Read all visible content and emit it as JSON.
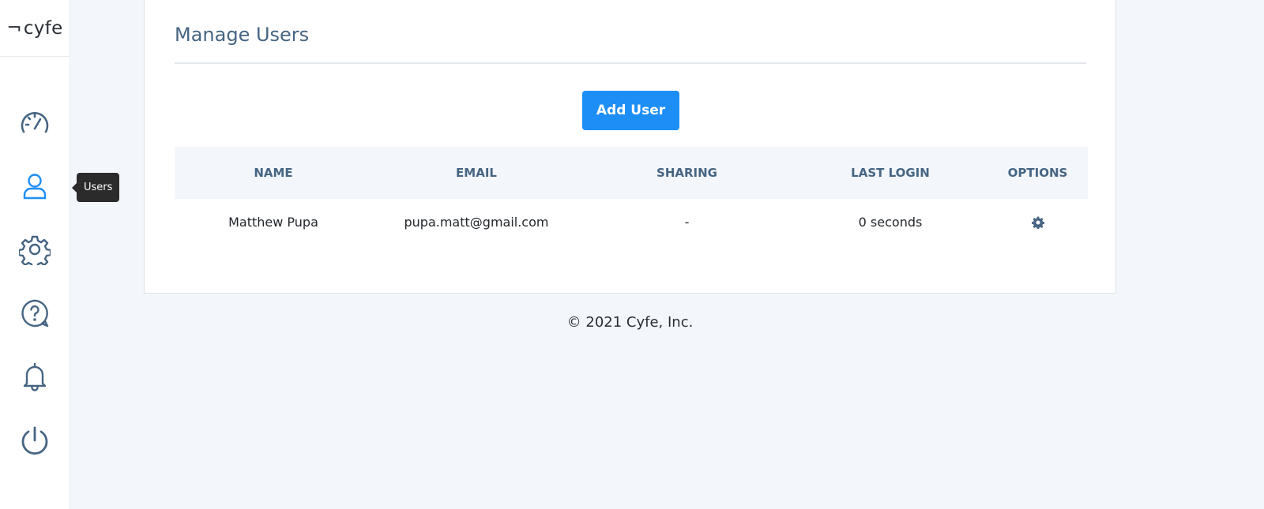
{
  "brand": {
    "mark": "¬",
    "name": "cyfe"
  },
  "sidebar": {
    "items": [
      {
        "name": "dashboards",
        "icon": "speedometer-icon"
      },
      {
        "name": "users",
        "icon": "user-icon",
        "active": true
      },
      {
        "name": "settings",
        "icon": "gear-icon"
      },
      {
        "name": "help",
        "icon": "help-bubble-icon"
      },
      {
        "name": "notifications",
        "icon": "bell-icon"
      },
      {
        "name": "logout",
        "icon": "power-icon"
      }
    ],
    "tooltip": "Users"
  },
  "main": {
    "title": "Manage Users",
    "add_button": "Add User",
    "table": {
      "headers": [
        "NAME",
        "EMAIL",
        "SHARING",
        "LAST LOGIN",
        "OPTIONS"
      ],
      "rows": [
        {
          "name": "Matthew Pupa",
          "email": "pupa.matt@gmail.com",
          "sharing": "-",
          "last_login": "0 seconds",
          "options_icon": "gear-icon"
        }
      ]
    }
  },
  "footer": "© 2021 Cyfe, Inc.",
  "colors": {
    "accent": "#1e8ef7",
    "icon": "#466583",
    "active_icon": "#1e8ef7",
    "background": "#f3f6fa"
  }
}
